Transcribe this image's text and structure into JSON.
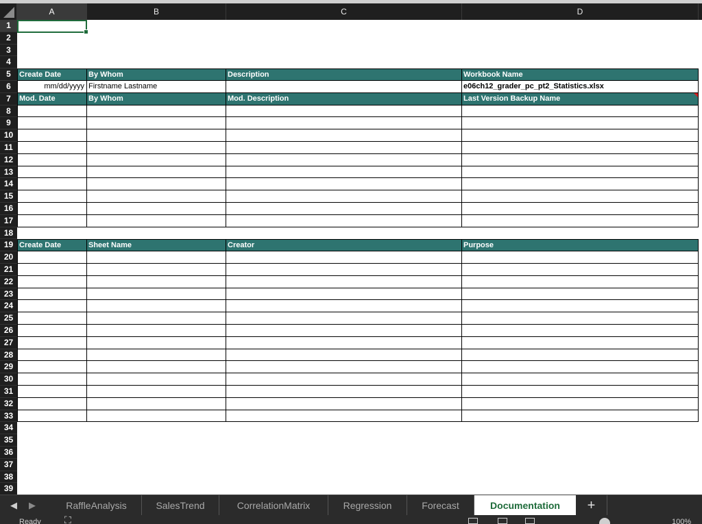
{
  "columns": [
    "A",
    "B",
    "C",
    "D"
  ],
  "rows": [
    "1",
    "2",
    "3",
    "4",
    "5",
    "6",
    "7",
    "8",
    "9",
    "10",
    "11",
    "12",
    "13",
    "14",
    "15",
    "16",
    "17",
    "18",
    "19",
    "20",
    "21",
    "22",
    "23",
    "24",
    "25",
    "26",
    "27",
    "28",
    "29",
    "30",
    "31",
    "32",
    "33",
    "34",
    "35",
    "36",
    "37",
    "38",
    "39"
  ],
  "selected_column": "A",
  "selected_row": "1",
  "header_fill_color": "#2e7470",
  "section1": {
    "header": [
      "Create Date",
      "By Whom",
      "Description",
      "Workbook Name"
    ],
    "values": [
      "mm/dd/yyyy",
      "Firstname Lastname",
      "",
      "e06ch12_grader_pc_pt2_Statistics.xlsx"
    ]
  },
  "section2": {
    "header": [
      "Mod. Date",
      "By Whom",
      "Mod. Description",
      "Last Version Backup Name"
    ]
  },
  "section3": {
    "header": [
      "Create Date",
      "Sheet Name",
      "Creator",
      "Purpose"
    ]
  },
  "tabs": [
    "RaffleAnalysis",
    "SalesTrend",
    "CorrelationMatrix",
    "Regression",
    "Forecast",
    "Documentation"
  ],
  "active_tab": "Documentation",
  "add_sheet_label": "+",
  "nav": {
    "prev": "◀",
    "next": "▶"
  },
  "status": {
    "ready": "Ready",
    "zoom": "100%"
  },
  "icons": {
    "accessibility": "accessibility-icon",
    "normal_view": "normal-view-icon",
    "page_layout": "page-layout-icon",
    "page_break": "page-break-preview-icon"
  }
}
